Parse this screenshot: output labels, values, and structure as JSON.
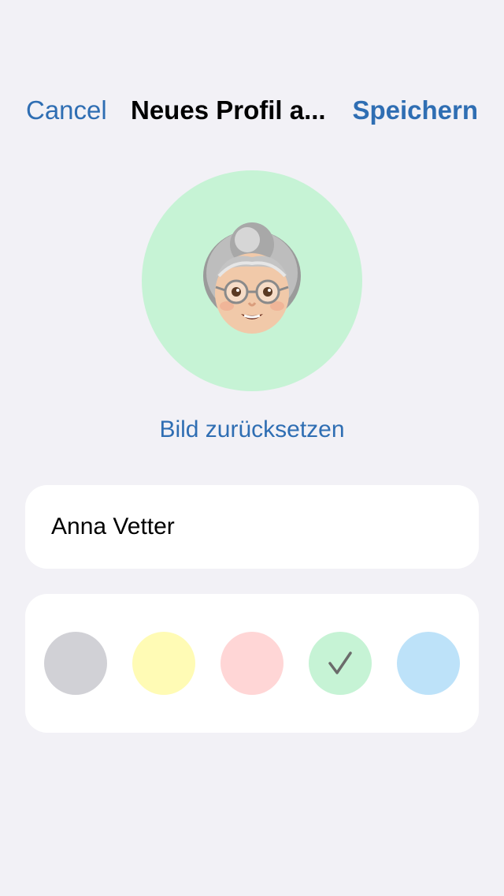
{
  "nav": {
    "cancel_label": "Cancel",
    "title": "Neues Profil a...",
    "save_label": "Speichern"
  },
  "avatar": {
    "icon": "grandmother-emoji-icon",
    "background": "#c6f3d5"
  },
  "reset_label": "Bild zurücksetzen",
  "name_field": {
    "value": "Anna Vetter"
  },
  "colors": [
    {
      "name": "gray",
      "hex": "#d1d1d6",
      "selected": false
    },
    {
      "name": "yellow",
      "hex": "#fffbb5",
      "selected": false
    },
    {
      "name": "pink",
      "hex": "#ffd6d6",
      "selected": false
    },
    {
      "name": "green",
      "hex": "#c6f3d5",
      "selected": true
    },
    {
      "name": "blue",
      "hex": "#bde2f9",
      "selected": false
    }
  ],
  "theme": {
    "accent": "#2f6eb3",
    "background": "#f2f1f6",
    "check": "#6b6b6b"
  }
}
